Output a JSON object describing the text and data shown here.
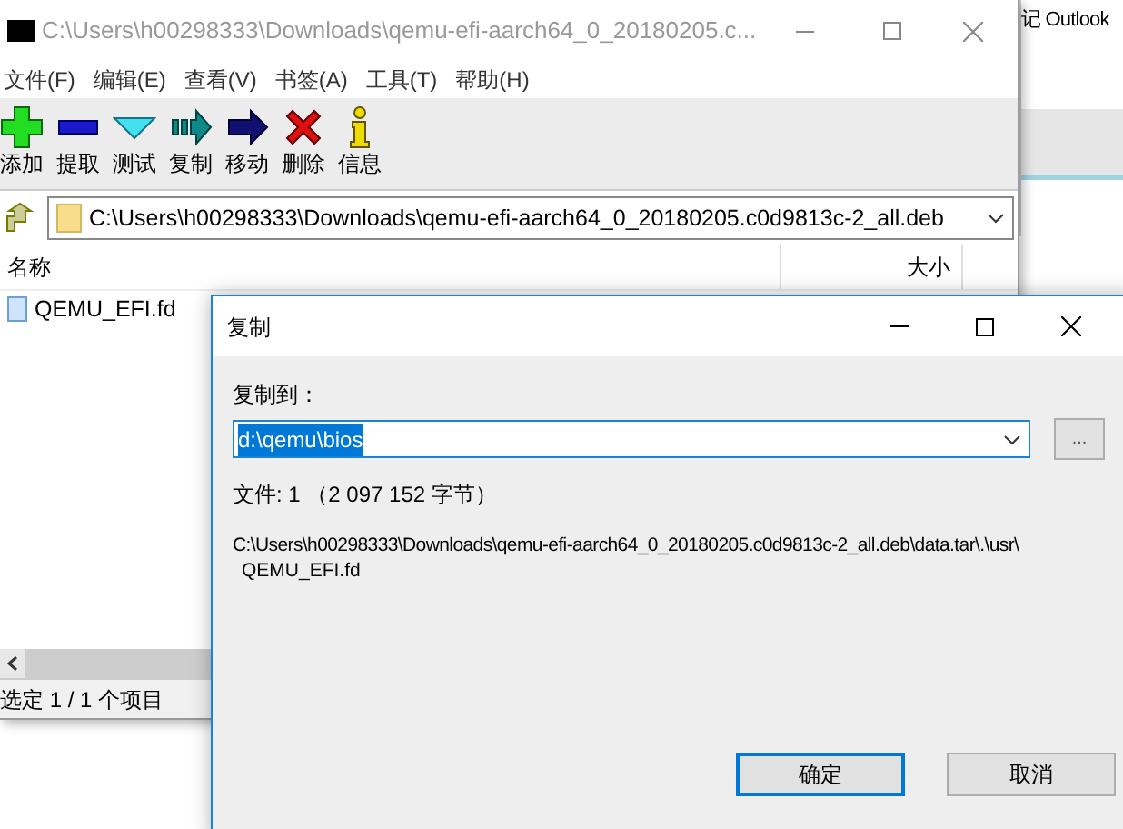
{
  "background_window": {
    "text": "记 Outlook"
  },
  "main_window": {
    "title": "C:\\Users\\h00298333\\Downloads\\qemu-efi-aarch64_0_20180205.c...",
    "menu": [
      "文件(F)",
      "编辑(E)",
      "查看(V)",
      "书签(A)",
      "工具(T)",
      "帮助(H)"
    ],
    "toolbar": [
      {
        "label": "添加",
        "kind": "add"
      },
      {
        "label": "提取",
        "kind": "extract"
      },
      {
        "label": "测试",
        "kind": "test"
      },
      {
        "label": "复制",
        "kind": "copy"
      },
      {
        "label": "移动",
        "kind": "move"
      },
      {
        "label": "删除",
        "kind": "delete"
      },
      {
        "label": "信息",
        "kind": "info"
      }
    ],
    "address": "C:\\Users\\h00298333\\Downloads\\qemu-efi-aarch64_0_20180205.c0d9813c-2_all.deb",
    "columns": [
      "名称",
      "大小"
    ],
    "files": [
      {
        "name": "QEMU_EFI.fd"
      }
    ],
    "status": "选定 1 / 1 个项目"
  },
  "dialog": {
    "title": "复制",
    "label": "复制到：",
    "destination": "d:\\qemu\\bios",
    "destination_selected": true,
    "browse": "...",
    "file_info": "文件: 1 （2 097 152 字节）",
    "source_path": [
      "C:\\Users\\h00298333\\Downloads\\qemu-efi-aarch64_0_20180205.c0d9813c-2_all.deb\\data.tar\\.\\usr\\",
      "QEMU_EFI.fd"
    ],
    "buttons": [
      {
        "label": "确定",
        "default": true
      },
      {
        "label": "取消",
        "default": false
      }
    ]
  }
}
